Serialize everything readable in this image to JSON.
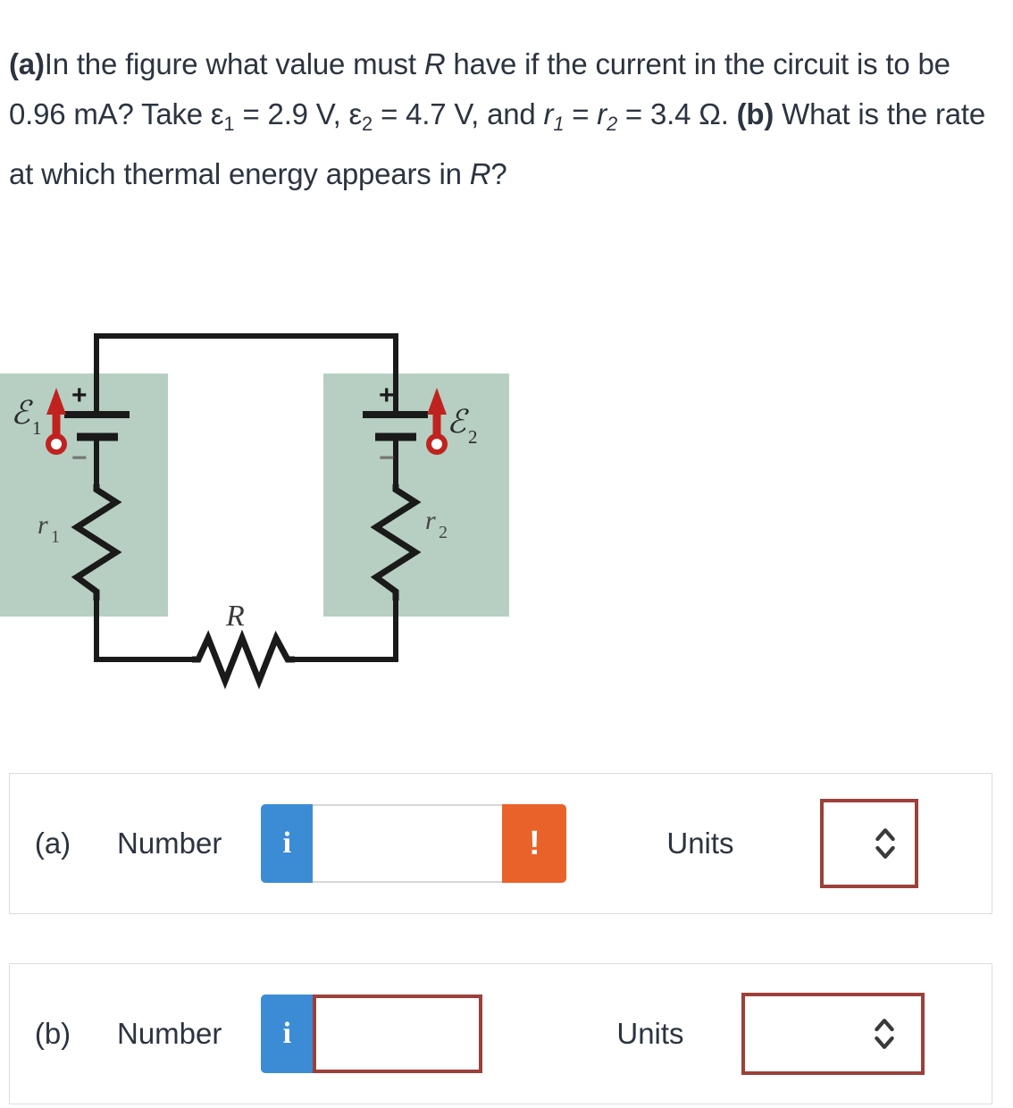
{
  "question": {
    "part_a_tag": "(a)",
    "part_a_text_1": "In the figure what value must ",
    "part_a_var_R": "R",
    "part_a_text_2": " have if the current in the circuit is to be 0.96 mA? Take ",
    "eps1_symbol": "ε",
    "eps1_sub": "1",
    "eps1_eq": " = 2.9 V, ",
    "eps2_symbol": "ε",
    "eps2_sub": "2",
    "eps2_eq": " = 4.7 V, and ",
    "r1_symbol": "r",
    "r1_sub": "1",
    "r_eq_mid": " = ",
    "r2_symbol": "r",
    "r2_sub": "2",
    "r_value": " = 3.4 Ω. ",
    "part_b_tag": "(b)",
    "part_b_text": " What is the rate at which thermal energy appears in ",
    "part_b_var_R": "R",
    "part_b_end": "?",
    "current": "0.96 mA",
    "eps1_value": "2.9 V",
    "eps2_value": "4.7 V",
    "r_internal_value": "3.4 Ω"
  },
  "figure": {
    "label_eps1": "ε",
    "label_eps1_sub": "1",
    "label_eps2": "ε",
    "label_eps2_sub": "2",
    "label_r1": "r",
    "label_r1_sub": "1",
    "label_r2": "r",
    "label_r2_sub": "2",
    "label_R": "R",
    "plus_sign": "+",
    "minus_sign": "−",
    "panel_color": "#b6cfc2",
    "wire_color": "#1a1a1a",
    "arrow_color": "#c0231f"
  },
  "answers": [
    {
      "tag": "(a)",
      "label": "Number",
      "value": "",
      "info_icon": "info-icon",
      "info_glyph": "i",
      "has_warning": true,
      "warning_glyph": "!",
      "units_label": "Units",
      "units_value": "",
      "select_icon": "chevron-updown-icon"
    },
    {
      "tag": "(b)",
      "label": "Number",
      "value": "",
      "info_icon": "info-icon",
      "info_glyph": "i",
      "has_warning": false,
      "warning_glyph": "",
      "units_label": "Units",
      "units_value": "",
      "select_icon": "chevron-updown-icon"
    }
  ],
  "colors": {
    "info_blue": "#3c8cd5",
    "warning_orange": "#e9622a",
    "error_red": "#9c4039",
    "text": "#2b3440",
    "panel_green": "#b6cfc2"
  }
}
